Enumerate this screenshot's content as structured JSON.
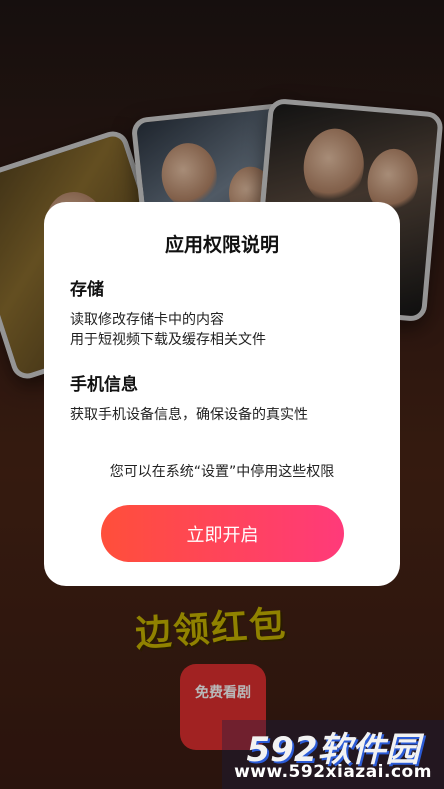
{
  "background": {
    "promo_text": "边领红包",
    "app_badge_label": "免费看剧"
  },
  "dialog": {
    "title": "应用权限说明",
    "sections": [
      {
        "title": "存储",
        "lines": [
          "读取修改存储卡中的内容",
          "用于短视频下载及缓存相关文件"
        ]
      },
      {
        "title": "手机信息",
        "lines": [
          "获取手机设备信息，确保设备的真实性"
        ]
      }
    ],
    "settings_hint": "您可以在系统“设置”中停用这些权限",
    "enable_button_label": "立即开启"
  },
  "watermark": {
    "logo": "592软件园",
    "url": "www.592xiazai.com"
  },
  "colors": {
    "button_gradient_start": "#ff4f3a",
    "button_gradient_end": "#ff3a7a",
    "dialog_bg": "#ffffff"
  }
}
